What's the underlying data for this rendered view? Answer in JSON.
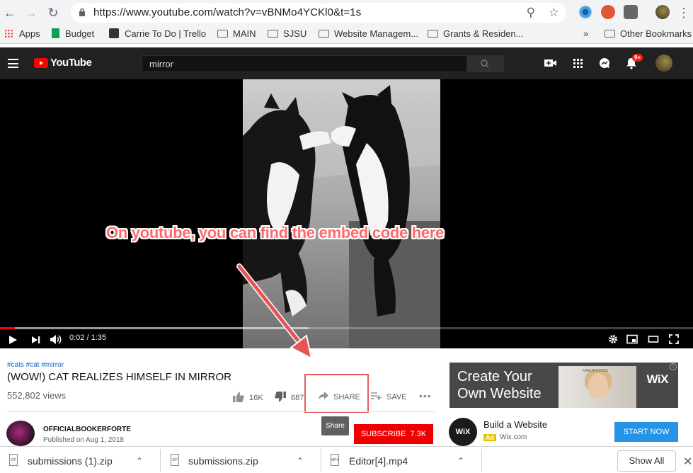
{
  "browser": {
    "url": "https://www.youtube.com/watch?v=vBNMo4YCKl0&t=1s",
    "bookmarks": [
      "Apps",
      "Budget",
      "Carrie To Do | Trello",
      "MAIN",
      "SJSU",
      "Website Managem...",
      "Grants & Residen..."
    ],
    "overflow": "»",
    "other_bookmarks": "Other Bookmarks"
  },
  "youtube": {
    "logo_text": "YouTube",
    "search_value": "mirror",
    "notification_count": "9+"
  },
  "player": {
    "current_time": "0:02",
    "duration": "1:35",
    "time_display": "0:02 / 1:35",
    "played_fraction": 0.021,
    "buffered_fraction": 0.445
  },
  "annotation": "On youtube, you can find the embed code here",
  "video": {
    "hashtags": "#cats #cat #mirror",
    "title": "(WOW!) CAT REALIZES HIMSELF IN MIRROR",
    "views": "552,802 views",
    "likes": "16K",
    "dislikes": "687",
    "share_label": "SHARE",
    "save_label": "SAVE",
    "share_tooltip": "Share"
  },
  "channel": {
    "name": "OFFICIALBOOKERFORTE",
    "published": "Published on Aug 1, 2018",
    "subscribe_label": "SUBSCRIBE",
    "subscriber_count": "7.3K"
  },
  "ad": {
    "headline": "Create Your Own Website",
    "brand": "WiX",
    "photo_caption": "KARLIE KLOSS",
    "logo": "WiX",
    "title": "Build a Website",
    "badge": "Ad",
    "domain": "Wix.com",
    "cta": "START NOW"
  },
  "downloads": {
    "items": [
      {
        "name": "submissions (1).zip",
        "type": "ZIP"
      },
      {
        "name": "submissions.zip",
        "type": "ZIP"
      },
      {
        "name": "Editor[4].mp4",
        "type": "MP4"
      }
    ],
    "show_all": "Show All"
  },
  "colors": {
    "youtube_red": "#ff0000",
    "annotation": "#ff6b6b",
    "wix_blue": "#2793e6",
    "subscribe_red": "#ee0000"
  }
}
